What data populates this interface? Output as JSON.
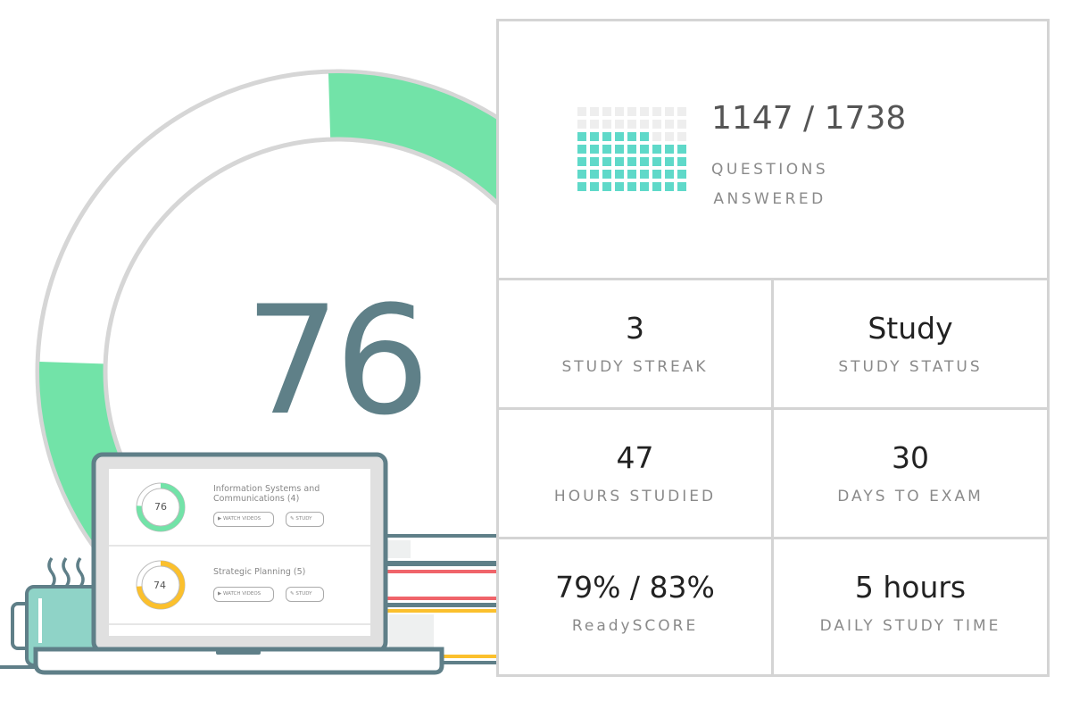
{
  "score_ring": {
    "value": "76",
    "percent": 76,
    "color": "#72e3a8"
  },
  "questions": {
    "answered": "1147 / 1738",
    "label_line1": "QUESTIONS",
    "label_line2": "ANSWERED",
    "grid": {
      "filled": 42,
      "total": 63,
      "filled_color": "#5fd9c9",
      "empty_color": "#eeeeee"
    }
  },
  "stats": [
    {
      "value": "3",
      "label": "STUDY STREAK"
    },
    {
      "value": "Study",
      "label": "STUDY STATUS"
    },
    {
      "value": "47",
      "label": "HOURS STUDIED"
    },
    {
      "value": "30",
      "label": "DAYS TO EXAM"
    },
    {
      "value": "79% / 83%",
      "label": "ReadySCORE"
    },
    {
      "value": "5 hours",
      "label": "DAILY STUDY TIME"
    }
  ],
  "laptop": {
    "topics": [
      {
        "score": "76",
        "percent": 76,
        "color": "#72e3a8",
        "title": "Information Systems and Communications (4)",
        "watch": "WATCH VIDEOS",
        "study": "STUDY"
      },
      {
        "score": "74",
        "percent": 74,
        "color": "#fbc02d",
        "title": "Strategic Planning (5)",
        "watch": "WATCH VIDEOS",
        "study": "STUDY"
      }
    ]
  },
  "colors": {
    "outline": "#5f7f88",
    "border": "#d4d4d4",
    "book_red": "#f0646a",
    "book_yellow": "#fbc02d",
    "mug": "#8fd3c7"
  }
}
